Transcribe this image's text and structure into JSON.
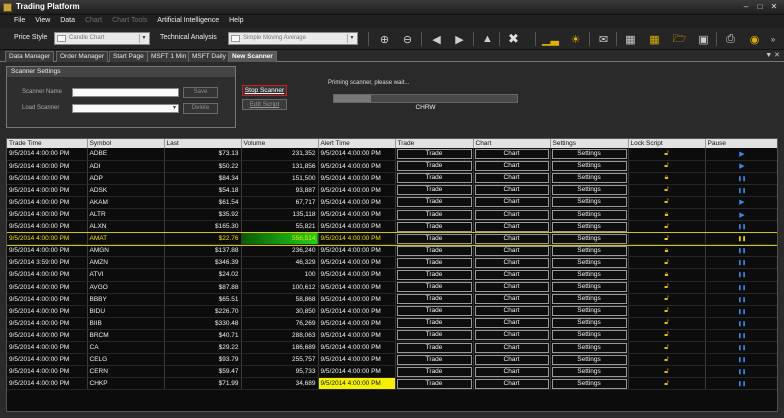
{
  "window": {
    "title": "Trading Platform"
  },
  "menu": [
    {
      "label": "File",
      "enabled": true
    },
    {
      "label": "View",
      "enabled": true
    },
    {
      "label": "Data",
      "enabled": true
    },
    {
      "label": "Chart",
      "enabled": false
    },
    {
      "label": "Chart Tools",
      "enabled": false
    },
    {
      "label": "Artificial Intelligence",
      "enabled": true
    },
    {
      "label": "Help",
      "enabled": true
    }
  ],
  "toolbar": {
    "price_style_label": "Price Style",
    "price_style_value": "Candle Chart",
    "technical_analysis_label": "Technical Analysis",
    "technical_analysis_value": "Simple Moving Average"
  },
  "tabs": [
    "Data Manager",
    "Order Manager",
    "Start Page",
    "MSFT 1 Min",
    "MSFT Daily",
    "New Scanner"
  ],
  "scanner_settings": {
    "header": "Scanner Settings",
    "name_label": "Scanner Name",
    "name_value": "",
    "load_label": "Load Scanner",
    "load_value": "",
    "save_label": "Save",
    "delete_label": "Delete"
  },
  "controls": {
    "stop_label": "Stop Scanner",
    "edit_label": "Edit Script",
    "status_text": "Priming scanner, please wait...",
    "progress_fraction": 0.2,
    "current_symbol": "CHRW"
  },
  "columns": [
    "Trade Time",
    "Symbol",
    "Last",
    "Volume",
    "Alert Time",
    "Trade",
    "Chart",
    "Settings",
    "Lock Script",
    "Pause"
  ],
  "button_labels": {
    "trade": "Trade",
    "chart": "Chart",
    "settings": "Settings"
  },
  "rows": [
    {
      "trade_time": "9/5/2014 4:00:00 PM",
      "symbol": "ADBE",
      "last": "$73.13",
      "volume": "231,352",
      "alert_time": "9/5/2014 4:00:00 PM",
      "lock": "open",
      "pause": "play"
    },
    {
      "trade_time": "9/5/2014 4:00:00 PM",
      "symbol": "ADI",
      "last": "$50.22",
      "volume": "131,856",
      "alert_time": "9/5/2014 4:00:00 PM",
      "lock": "open",
      "pause": "play"
    },
    {
      "trade_time": "9/5/2014 4:00:00 PM",
      "symbol": "ADP",
      "last": "$84.34",
      "volume": "151,500",
      "alert_time": "9/5/2014 4:00:00 PM",
      "lock": "locked",
      "pause": "pause"
    },
    {
      "trade_time": "9/5/2014 4:00:00 PM",
      "symbol": "ADSK",
      "last": "$54.18",
      "volume": "93,887",
      "alert_time": "9/5/2014 4:00:00 PM",
      "lock": "open",
      "pause": "pause"
    },
    {
      "trade_time": "9/5/2014 4:00:00 PM",
      "symbol": "AKAM",
      "last": "$61.54",
      "volume": "67,717",
      "alert_time": "9/5/2014 4:00:00 PM",
      "lock": "open",
      "pause": "play"
    },
    {
      "trade_time": "9/5/2014 4:00:00 PM",
      "symbol": "ALTR",
      "last": "$35.92",
      "volume": "135,118",
      "alert_time": "9/5/2014 4:00:00 PM",
      "lock": "locked",
      "pause": "play"
    },
    {
      "trade_time": "9/5/2014 4:00:00 PM",
      "symbol": "ALXN",
      "last": "$165.30",
      "volume": "55,821",
      "alert_time": "9/5/2014 4:00:00 PM",
      "lock": "open",
      "pause": "pause"
    },
    {
      "trade_time": "9/5/2014 4:00:00 PM",
      "symbol": "AMAT",
      "last": "$22.76",
      "volume": "556,514",
      "alert_time": "9/5/2014 4:00:00 PM",
      "lock": "open",
      "pause": "pause",
      "highlight": true
    },
    {
      "trade_time": "9/5/2014 4:00:00 PM",
      "symbol": "AMGN",
      "last": "$137.88",
      "volume": "236,240",
      "alert_time": "9/5/2014 4:00:00 PM",
      "lock": "locked",
      "pause": "pause"
    },
    {
      "trade_time": "9/5/2014 3:59:00 PM",
      "symbol": "AMZN",
      "last": "$346.39",
      "volume": "46,329",
      "alert_time": "9/5/2014 4:00:00 PM",
      "lock": "open",
      "pause": "pause"
    },
    {
      "trade_time": "9/5/2014 4:00:00 PM",
      "symbol": "ATVI",
      "last": "$24.02",
      "volume": "100",
      "alert_time": "9/5/2014 4:00:00 PM",
      "lock": "locked",
      "pause": "pause"
    },
    {
      "trade_time": "9/5/2014 4:00:00 PM",
      "symbol": "AVGO",
      "last": "$87.88",
      "volume": "100,612",
      "alert_time": "9/5/2014 4:00:00 PM",
      "lock": "open",
      "pause": "pause"
    },
    {
      "trade_time": "9/5/2014 4:00:00 PM",
      "symbol": "BBBY",
      "last": "$65.51",
      "volume": "58,868",
      "alert_time": "9/5/2014 4:00:00 PM",
      "lock": "open",
      "pause": "pause"
    },
    {
      "trade_time": "9/5/2014 4:00:00 PM",
      "symbol": "BIDU",
      "last": "$226.70",
      "volume": "30,850",
      "alert_time": "9/5/2014 4:00:00 PM",
      "lock": "open",
      "pause": "pause"
    },
    {
      "trade_time": "9/5/2014 4:00:00 PM",
      "symbol": "BIIB",
      "last": "$330.48",
      "volume": "76,269",
      "alert_time": "9/5/2014 4:00:00 PM",
      "lock": "open",
      "pause": "pause"
    },
    {
      "trade_time": "9/5/2014 4:00:00 PM",
      "symbol": "BRCM",
      "last": "$40.71",
      "volume": "288,063",
      "alert_time": "9/5/2014 4:00:00 PM",
      "lock": "open",
      "pause": "pause"
    },
    {
      "trade_time": "9/5/2014 4:00:00 PM",
      "symbol": "CA",
      "last": "$29.22",
      "volume": "186,689",
      "alert_time": "9/5/2014 4:00:00 PM",
      "lock": "open",
      "pause": "pause"
    },
    {
      "trade_time": "9/5/2014 4:00:00 PM",
      "symbol": "CELG",
      "last": "$93.79",
      "volume": "255,757",
      "alert_time": "9/5/2014 4:00:00 PM",
      "lock": "open",
      "pause": "pause"
    },
    {
      "trade_time": "9/5/2014 4:00:00 PM",
      "symbol": "CERN",
      "last": "$59.47",
      "volume": "95,733",
      "alert_time": "9/5/2014 4:00:00 PM",
      "lock": "open",
      "pause": "pause"
    },
    {
      "trade_time": "9/5/2014 4:00:00 PM",
      "symbol": "CHKP",
      "last": "$71.99",
      "volume": "34,689",
      "alert_time": "9/5/2014 4:00:00 PM",
      "lock": "open",
      "pause": "pause",
      "alert_highlight": true
    }
  ],
  "colors": {
    "highlight_text": "#f0e000",
    "volume_green": "#21d21b",
    "alert_yellow": "#f5f000",
    "play_blue": "#3f87e6",
    "lock_gold": "#e8c000",
    "stop_red": "#d21e1e"
  },
  "icons": [
    "zoom-in-icon",
    "zoom-out-icon",
    "back-icon",
    "forward-icon",
    "chart-up-icon",
    "delete-x-icon",
    "bar-chart-icon",
    "ai-bulb-icon",
    "chat-icon",
    "grid-icon",
    "table-icon",
    "open-folder-icon",
    "save-disk-icon",
    "print-icon",
    "globe-icon"
  ]
}
